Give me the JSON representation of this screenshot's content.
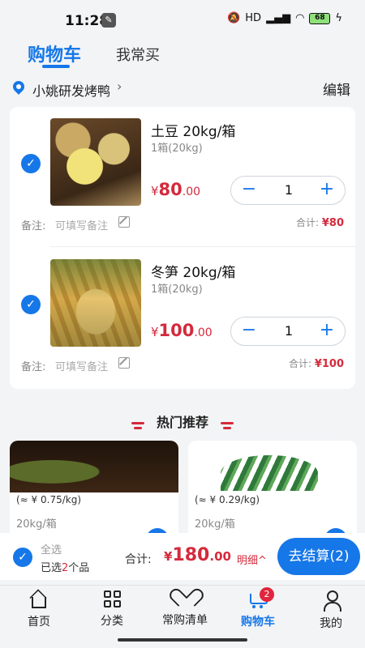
{
  "status": {
    "time": "11:28",
    "network": "HD",
    "battery": "68"
  },
  "tabs": {
    "active": "购物车",
    "other": "我常买"
  },
  "store": {
    "name": "小姚研发烤鸭",
    "edit": "编辑"
  },
  "cart": {
    "items": [
      {
        "name": "土豆 20kg/箱",
        "spec": "1箱(20kg)",
        "price_yen": "¥",
        "price_int": "80",
        "price_dec": ".00",
        "qty": "1",
        "minus": "−",
        "plus": "+",
        "note_label": "备注:",
        "note_placeholder": "可填写备注",
        "subtotal_label": "合计:",
        "subtotal": "¥80"
      },
      {
        "name": "冬笋 20kg/箱",
        "spec": "1箱(20kg)",
        "price_yen": "¥",
        "price_int": "100",
        "price_dec": ".00",
        "qty": "1",
        "minus": "−",
        "plus": "+",
        "note_label": "备注:",
        "note_placeholder": "可填写备注",
        "subtotal_label": "合计:",
        "subtotal": "¥100"
      }
    ]
  },
  "recommend": {
    "title": "热门推荐",
    "items": [
      {
        "price": "(≈ ¥ 0.75/kg)",
        "unit": "20kg/箱"
      },
      {
        "price": "(≈ ¥ 0.29/kg)",
        "unit": "20kg/箱"
      }
    ]
  },
  "checkout": {
    "select_all": "全选",
    "selected_prefix": "已选",
    "selected_count": "2",
    "selected_suffix": "个品",
    "total_label": "合计:",
    "total_yen": "¥",
    "total_int": "180",
    "total_dec": ".00",
    "detail": "明细^",
    "button": "去结算(2)"
  },
  "nav": {
    "items": [
      "首页",
      "分类",
      "常购清单",
      "购物车",
      "我的"
    ],
    "cart_badge": "2"
  },
  "colors": {
    "accent": "#1677e8",
    "price": "#d42a3c"
  }
}
